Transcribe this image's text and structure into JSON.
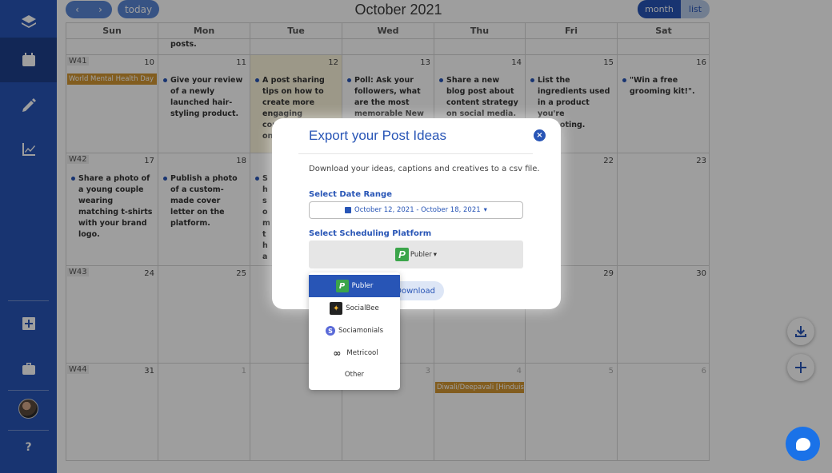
{
  "header": {
    "prev_label": "‹",
    "next_label": "›",
    "today_label": "today",
    "title": "October 2021",
    "view_month": "month",
    "view_list": "list"
  },
  "calendar": {
    "weekdays": [
      "Sun",
      "Mon",
      "Tue",
      "Wed",
      "Thu",
      "Fri",
      "Sat"
    ],
    "prev_week_text": "posts.",
    "weeks": [
      {
        "label": "W41",
        "days": [
          "10",
          "11",
          "12",
          "13",
          "14",
          "15",
          "16"
        ]
      },
      {
        "label": "W42",
        "days": [
          "17",
          "18",
          "",
          "",
          "",
          "22",
          "23"
        ]
      },
      {
        "label": "W43",
        "days": [
          "24",
          "25",
          "",
          "",
          "",
          "29",
          "30"
        ]
      },
      {
        "label": "W44",
        "days": [
          "31",
          "1",
          "",
          "3",
          "4",
          "5",
          "6"
        ]
      }
    ],
    "events": {
      "world_mental_health": "World Mental Health Day",
      "diwali": "Diwali/Deepavali [Hinduism]"
    },
    "posts": {
      "mon_11": "Give your review of a newly launched hair-styling product.",
      "tue_12": "A post sharing tips on how to create more engaging content with just one",
      "wed_13": "Poll: Ask your followers, what are the most memorable New",
      "thu_14": "Share a new blog post about content strategy on social media.",
      "fri_15": "List the ingredients used in a product you're promoting.",
      "sat_16": "\"Win a free grooming kit!\".",
      "sun_17": "Share a photo of a young couple wearing matching t-shirts with your brand logo.",
      "mon_18": "Publish a photo of a custom-made cover letter on the platform.",
      "tue_19": "Sh so m th av cr m co"
    }
  },
  "modal": {
    "title": "Export your Post Ideas",
    "close_label": "×",
    "description": "Download your ideas, captions and creatives to a csv file.",
    "date_range_label": "Select Date Range",
    "date_range_value": "October 12, 2021 - October 18, 2021",
    "platform_label": "Select Scheduling Platform",
    "platform_value": "Publer",
    "download_label": "Download"
  },
  "dropdown": {
    "options": [
      {
        "label": "Publer",
        "icon": "publer-logo",
        "selected": true
      },
      {
        "label": "SocialBee",
        "icon": "socialbee-logo",
        "selected": false
      },
      {
        "label": "Sociamonials",
        "icon": "sociamonials-logo",
        "selected": false
      },
      {
        "label": "Metricool",
        "icon": "metricool-logo",
        "selected": false
      },
      {
        "label": "Other",
        "icon": "",
        "selected": false
      }
    ]
  },
  "sidebar": {
    "help_label": "?"
  },
  "colors": {
    "brand": "#2855b6",
    "event": "#d29733",
    "today_bg": "#fcf6dc"
  }
}
